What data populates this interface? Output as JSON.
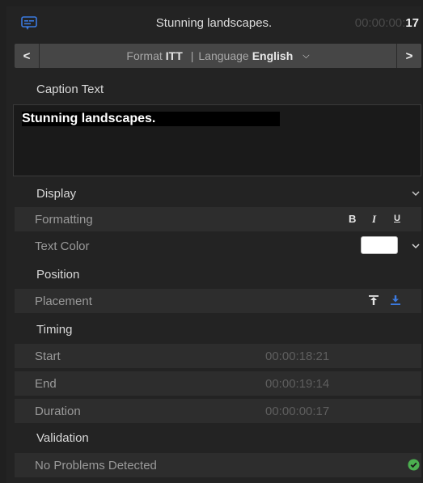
{
  "header": {
    "title": "Stunning landscapes.",
    "timecode_dim": "00:00:00:",
    "timecode_frames": "17",
    "icon": "captions-icon"
  },
  "nav": {
    "prev_label": "<",
    "next_label": ">",
    "format_label": "Format",
    "format_value": "ITT",
    "separator": "|",
    "language_label": "Language",
    "language_value": "English",
    "dropdown_icon": "chevron-down-icon"
  },
  "caption": {
    "section_label": "Caption Text",
    "text": "Stunning landscapes."
  },
  "display": {
    "section_label": "Display",
    "formatting_label": "Formatting",
    "bold": "B",
    "italic": "I",
    "underline": "U",
    "text_color_label": "Text Color",
    "text_color": "#ffffff"
  },
  "position": {
    "section_label": "Position",
    "placement_label": "Placement",
    "icons": [
      "align-top-icon",
      "align-bottom-icon"
    ]
  },
  "timing": {
    "section_label": "Timing",
    "start_label": "Start",
    "start_value": "00:00:18:21",
    "end_label": "End",
    "end_value": "00:00:19:14",
    "duration_label": "Duration",
    "duration_value": "00:00:00:17"
  },
  "validation": {
    "section_label": "Validation",
    "status": "No Problems Detected",
    "status_icon": "checkmark-circle-icon",
    "status_color": "#4caf50"
  },
  "colors": {
    "accent": "#3b7ae0",
    "background": "#232323",
    "row": "#2d2d2d"
  }
}
